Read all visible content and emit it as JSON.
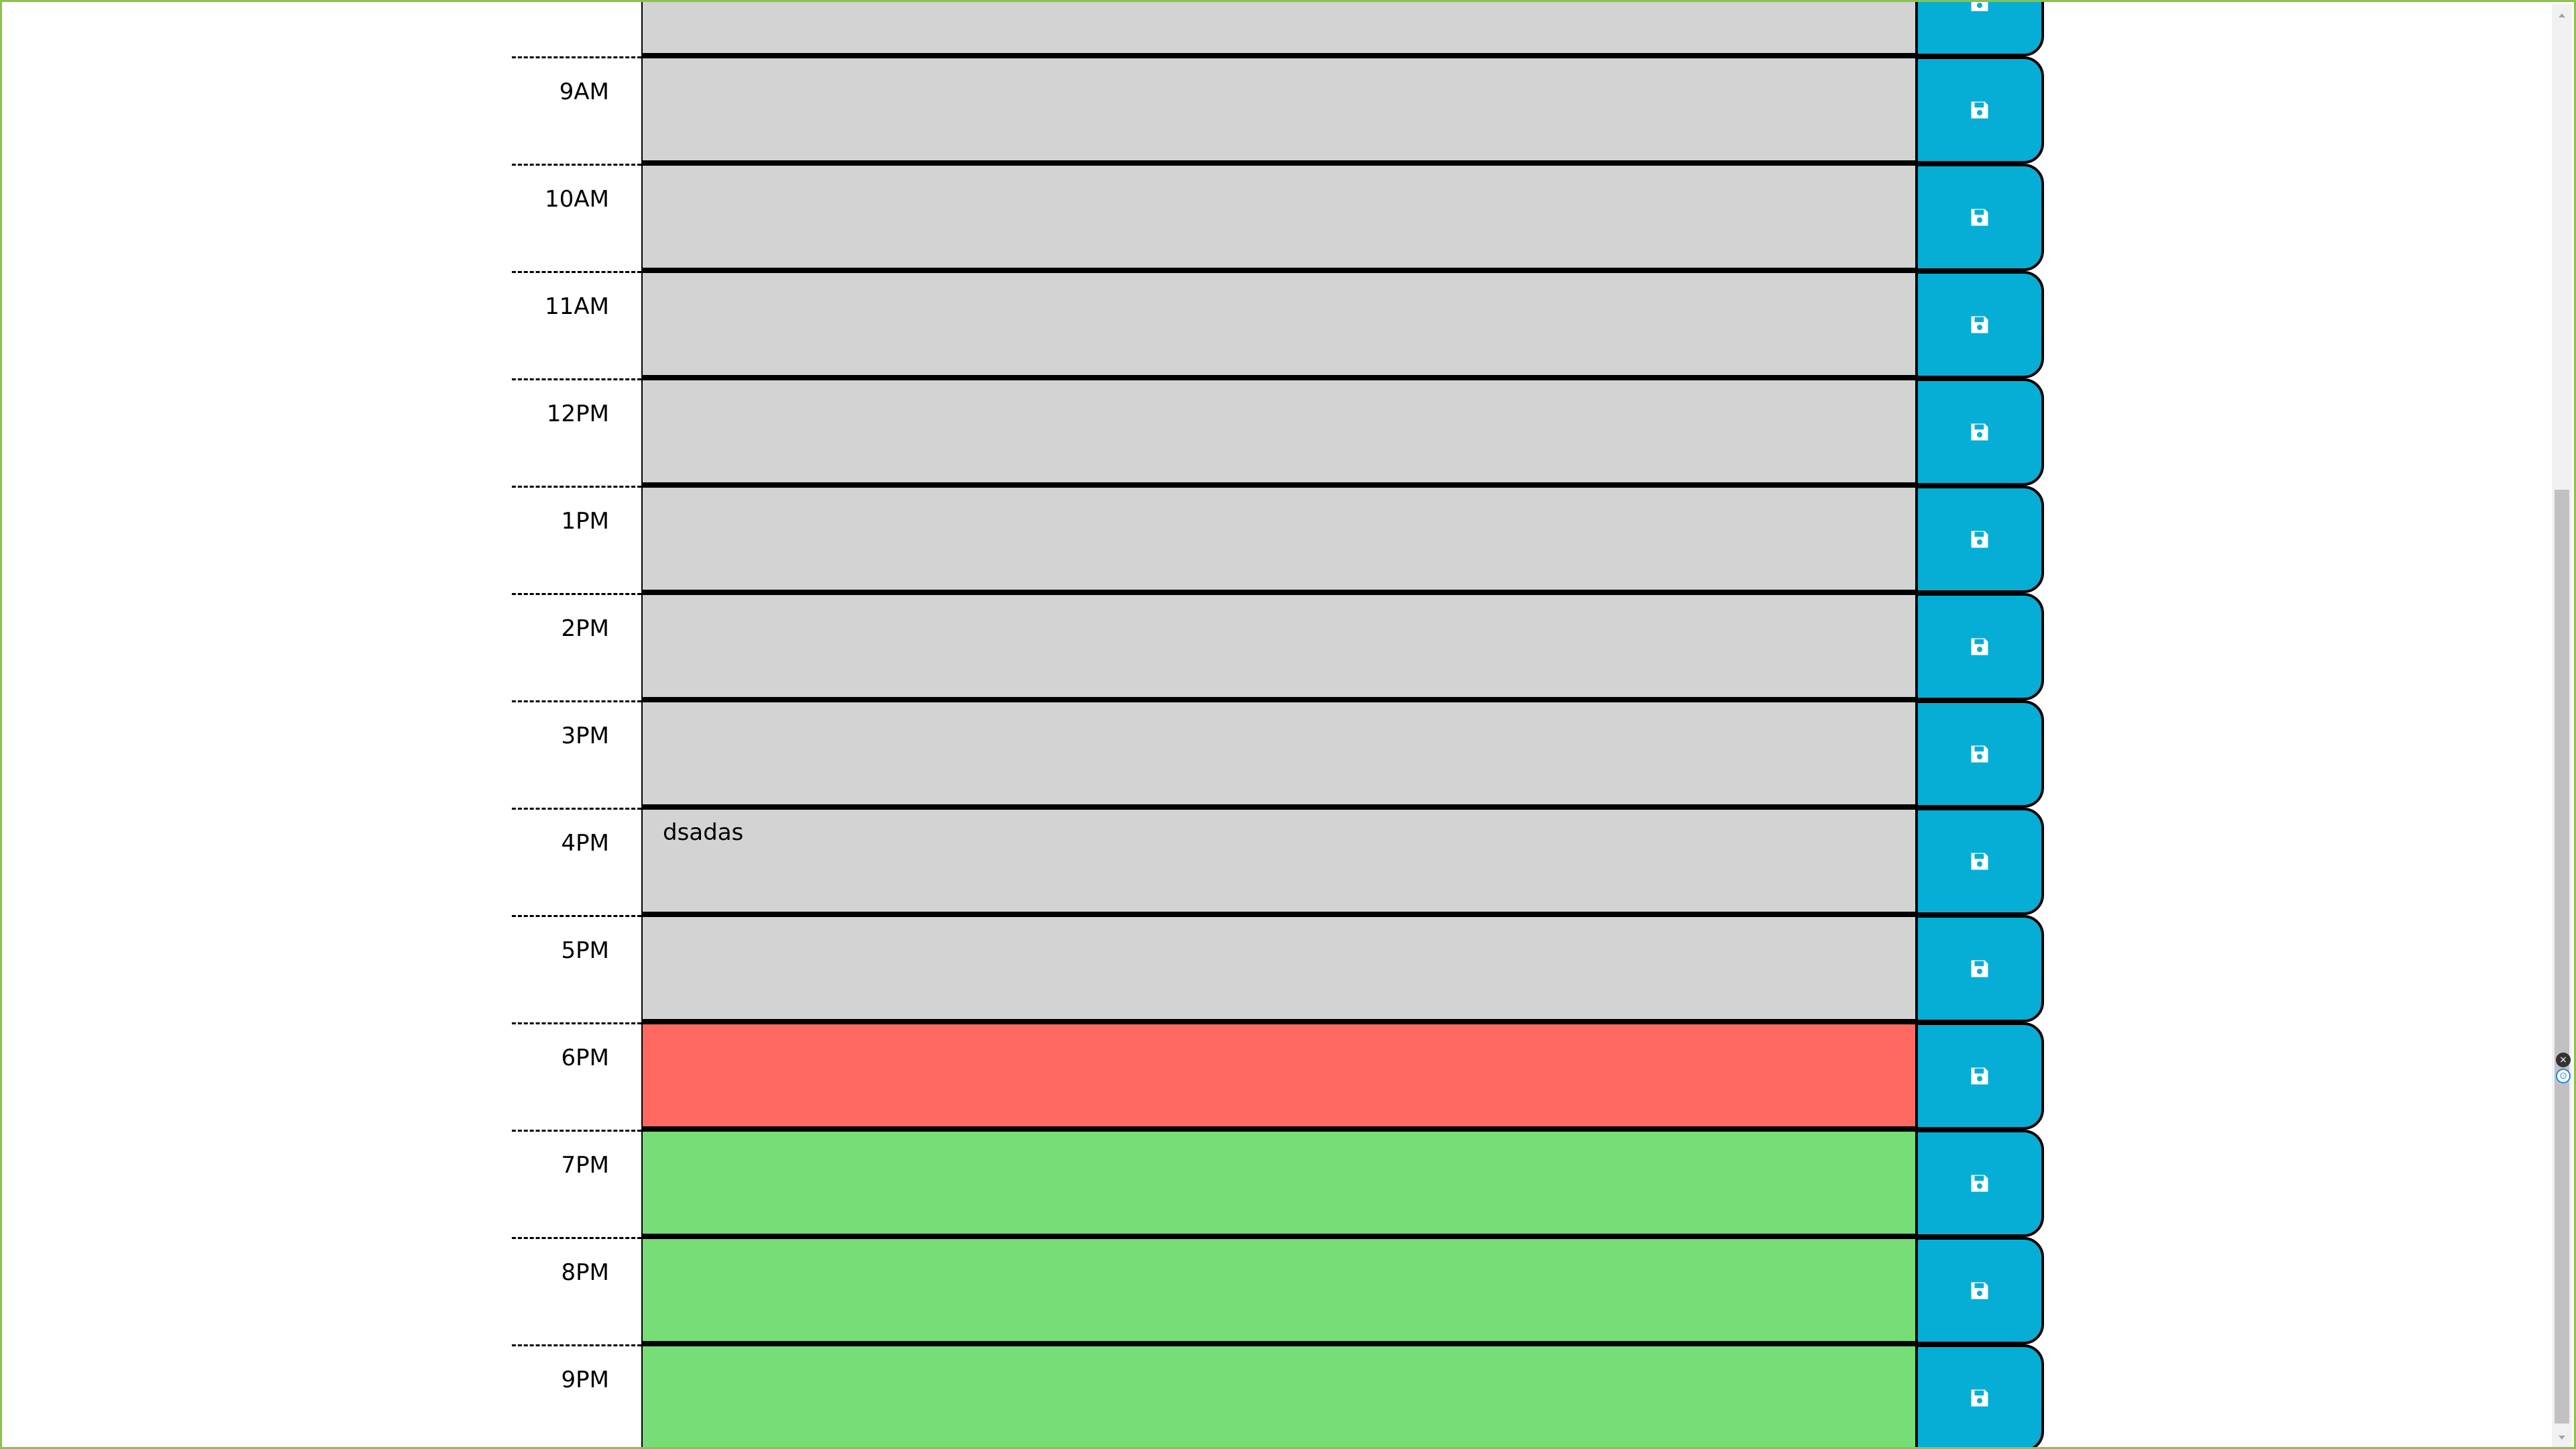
{
  "colors": {
    "past": "#d3d3d3",
    "present": "#ff6961",
    "future": "#77dd77",
    "save": "#06aed5",
    "frame": "#8bc34a"
  },
  "icons": {
    "save": "floppy-disk-icon"
  },
  "rows": [
    {
      "hour": "",
      "text": "",
      "state": "past"
    },
    {
      "hour": "9AM",
      "text": "",
      "state": "past"
    },
    {
      "hour": "10AM",
      "text": "",
      "state": "past"
    },
    {
      "hour": "11AM",
      "text": "",
      "state": "past"
    },
    {
      "hour": "12PM",
      "text": "",
      "state": "past"
    },
    {
      "hour": "1PM",
      "text": "",
      "state": "past"
    },
    {
      "hour": "2PM",
      "text": "",
      "state": "past"
    },
    {
      "hour": "3PM",
      "text": "",
      "state": "past"
    },
    {
      "hour": "4PM",
      "text": "dsadas",
      "state": "past"
    },
    {
      "hour": "5PM",
      "text": "",
      "state": "past"
    },
    {
      "hour": "6PM",
      "text": "",
      "state": "present"
    },
    {
      "hour": "7PM",
      "text": "",
      "state": "future"
    },
    {
      "hour": "8PM",
      "text": "",
      "state": "future"
    },
    {
      "hour": "9PM",
      "text": "",
      "state": "future"
    }
  ]
}
